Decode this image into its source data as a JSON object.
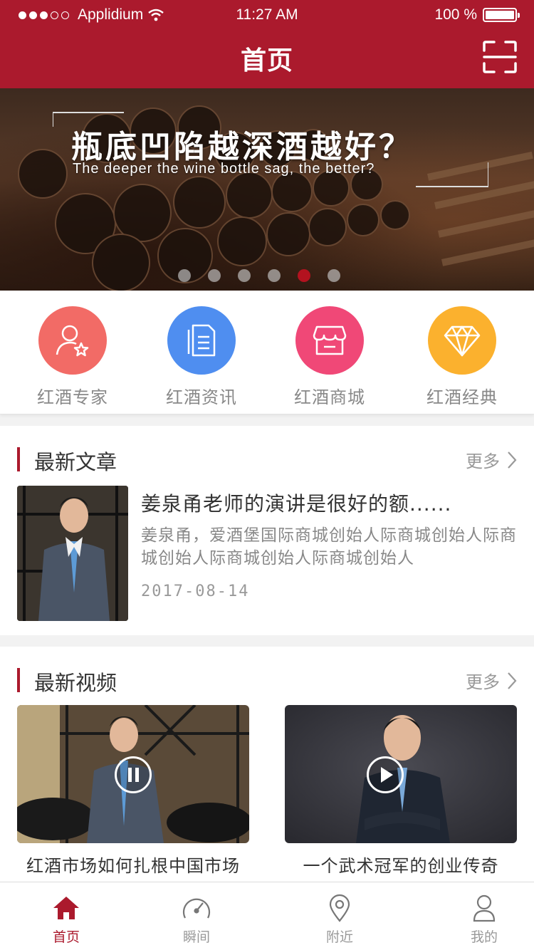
{
  "status_bar": {
    "carrier": "Applidium",
    "time": "11:27 AM",
    "battery": "100 %"
  },
  "header": {
    "title": "首页"
  },
  "banner": {
    "title_cn": "瓶底凹陷越深酒越好？",
    "title_en": "The deeper the wine bottle sag, the better?",
    "page_count": 6,
    "active_page": 5
  },
  "categories": [
    {
      "label": "红酒专家",
      "icon": "user-star-icon",
      "color": "#f26b66"
    },
    {
      "label": "红酒资讯",
      "icon": "document-icon",
      "color": "#4f8ef0"
    },
    {
      "label": "红酒商城",
      "icon": "shop-icon",
      "color": "#f04877"
    },
    {
      "label": "红酒经典",
      "icon": "diamond-icon",
      "color": "#fbb12e"
    }
  ],
  "articles": {
    "title": "最新文章",
    "more": "更多",
    "item": {
      "title": "姜泉甬老师的演讲是很好的额......",
      "desc": "姜泉甬，爱酒堡国际商城创始人际商城创始人际商城创始人际商城创始人际商城创始人",
      "date": "2017-08-14"
    }
  },
  "videos": {
    "title": "最新视频",
    "more": "更多",
    "items": [
      {
        "caption": "红酒市场如何扎根中国市场"
      },
      {
        "caption": "一个武术冠军的创业传奇"
      }
    ]
  },
  "tabbar": {
    "items": [
      {
        "label": "首页",
        "icon": "home-icon"
      },
      {
        "label": "瞬间",
        "icon": "gauge-icon"
      },
      {
        "label": "附近",
        "icon": "location-pin-icon"
      },
      {
        "label": "我的",
        "icon": "user-icon"
      }
    ],
    "active_color": "#ab1a2d"
  },
  "colors": {
    "brand": "#ab1a2d"
  }
}
